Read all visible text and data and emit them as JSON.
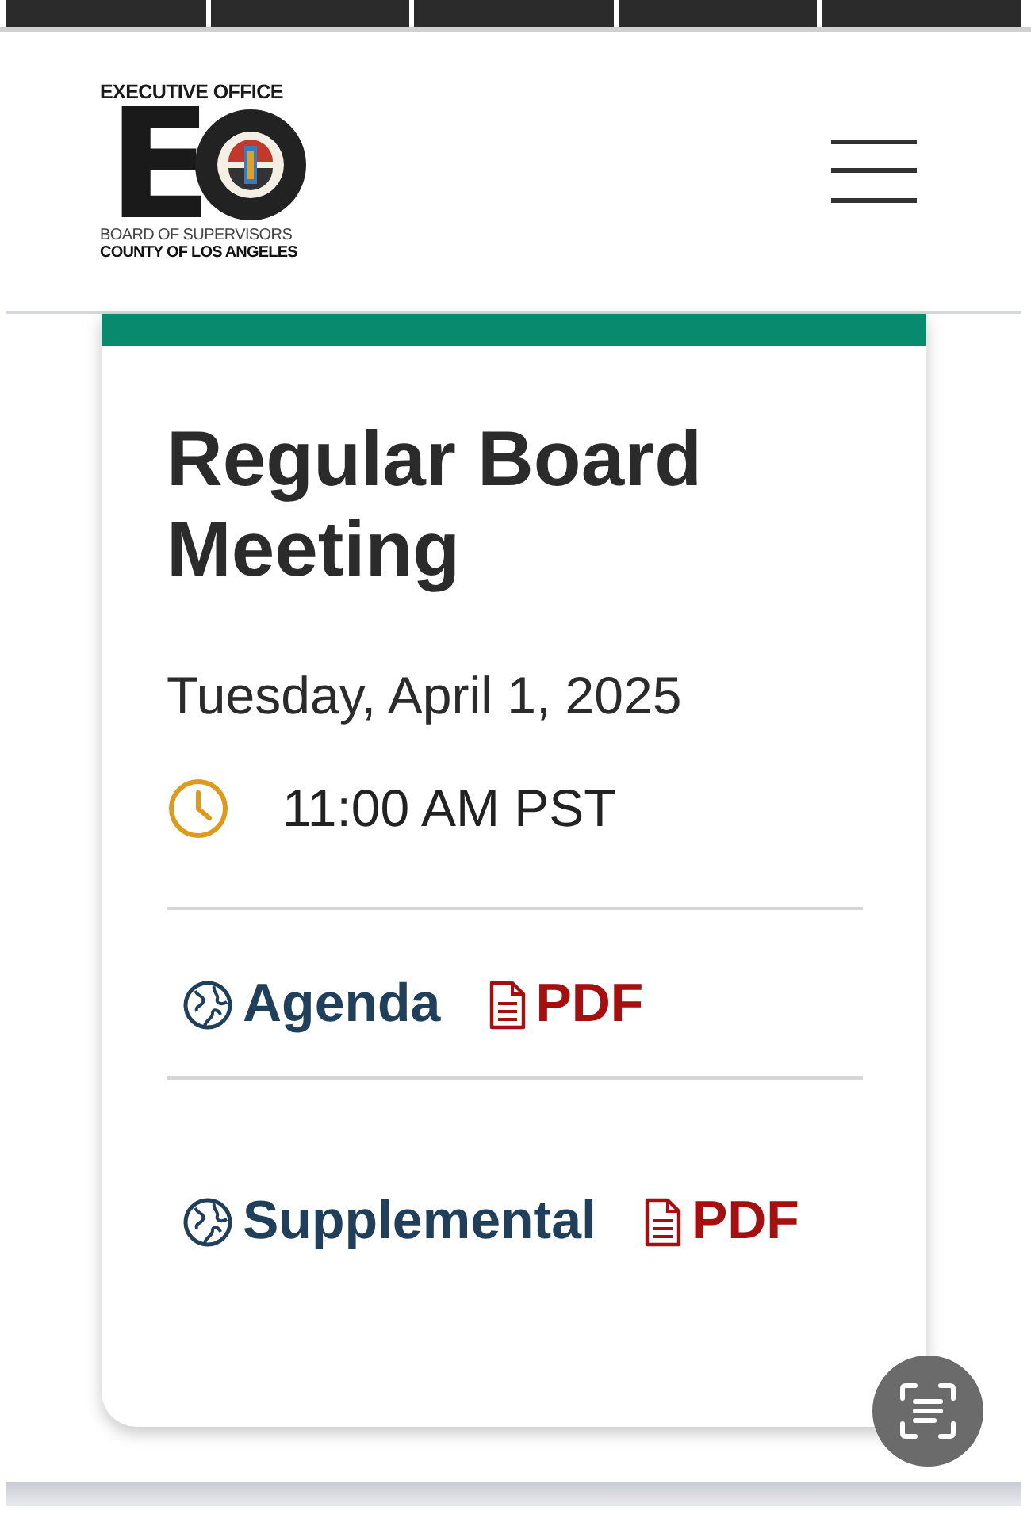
{
  "top_tabs": [
    {
      "kind": "tab"
    },
    {
      "kind": "tab"
    },
    {
      "kind": "tab"
    },
    {
      "kind": "tab"
    },
    {
      "kind": "tab"
    }
  ],
  "logo": {
    "top": "EXECUTIVE OFFICE",
    "mark": "E",
    "line1": "BOARD OF SUPERVISORS",
    "line2": "COUNTY OF LOS ANGELES"
  },
  "card": {
    "title": "Regular Board Meeting",
    "date": "Tuesday, April 1, 2025",
    "time": "11:00 AM PST",
    "links": [
      {
        "label": "Agenda",
        "pdf": "PDF"
      },
      {
        "label": "Supplemental",
        "pdf": "PDF"
      }
    ]
  }
}
